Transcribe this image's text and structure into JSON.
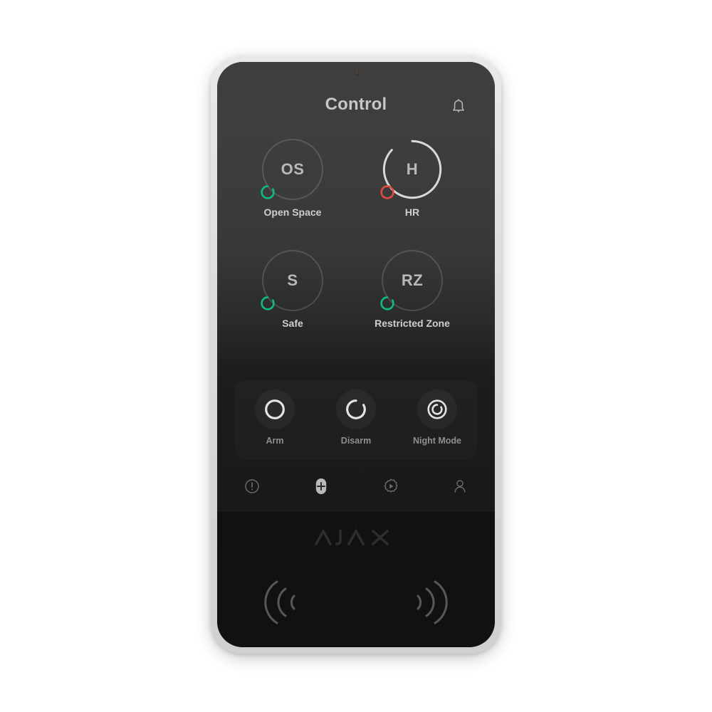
{
  "device": {
    "brand": "AJAX",
    "body_color": "#dcdcdc",
    "screen_bg_top": "#3f3f3f",
    "screen_bg_bottom": "#191919"
  },
  "header": {
    "title": "Control",
    "bell_icon": "bell-icon"
  },
  "groups": [
    {
      "abbr": "OS",
      "name": "Open Space",
      "state": "disarmed",
      "badge_icon": "disarm-arc-icon",
      "badge_color": "#0dbd7e",
      "ring_selected": false
    },
    {
      "abbr": "H",
      "name": "HR",
      "state": "alarm",
      "badge_icon": "alarm-circle-icon",
      "badge_color": "#e04b3c",
      "ring_selected": true
    },
    {
      "abbr": "S",
      "name": "Safe",
      "state": "disarmed",
      "badge_icon": "disarm-arc-icon",
      "badge_color": "#0dbd7e",
      "ring_selected": false
    },
    {
      "abbr": "RZ",
      "name": "Restricted Zone",
      "state": "disarmed",
      "badge_icon": "disarm-arc-icon",
      "badge_color": "#0dbd7e",
      "ring_selected": false
    }
  ],
  "modes": [
    {
      "label": "Arm",
      "icon": "arm-circle-icon"
    },
    {
      "label": "Disarm",
      "icon": "disarm-arc-icon"
    },
    {
      "label": "Night Mode",
      "icon": "night-mode-icon"
    }
  ],
  "nav": [
    {
      "icon": "alert-exclamation-icon",
      "name": "alerts"
    },
    {
      "icon": "add-plus-icon",
      "name": "add",
      "active": true
    },
    {
      "icon": "scenario-gear-play-icon",
      "name": "scenarios"
    },
    {
      "icon": "user-profile-icon",
      "name": "profile"
    }
  ],
  "reader": {
    "left_icon": "rfid-wave-left-icon",
    "right_icon": "rfid-wave-right-icon"
  }
}
